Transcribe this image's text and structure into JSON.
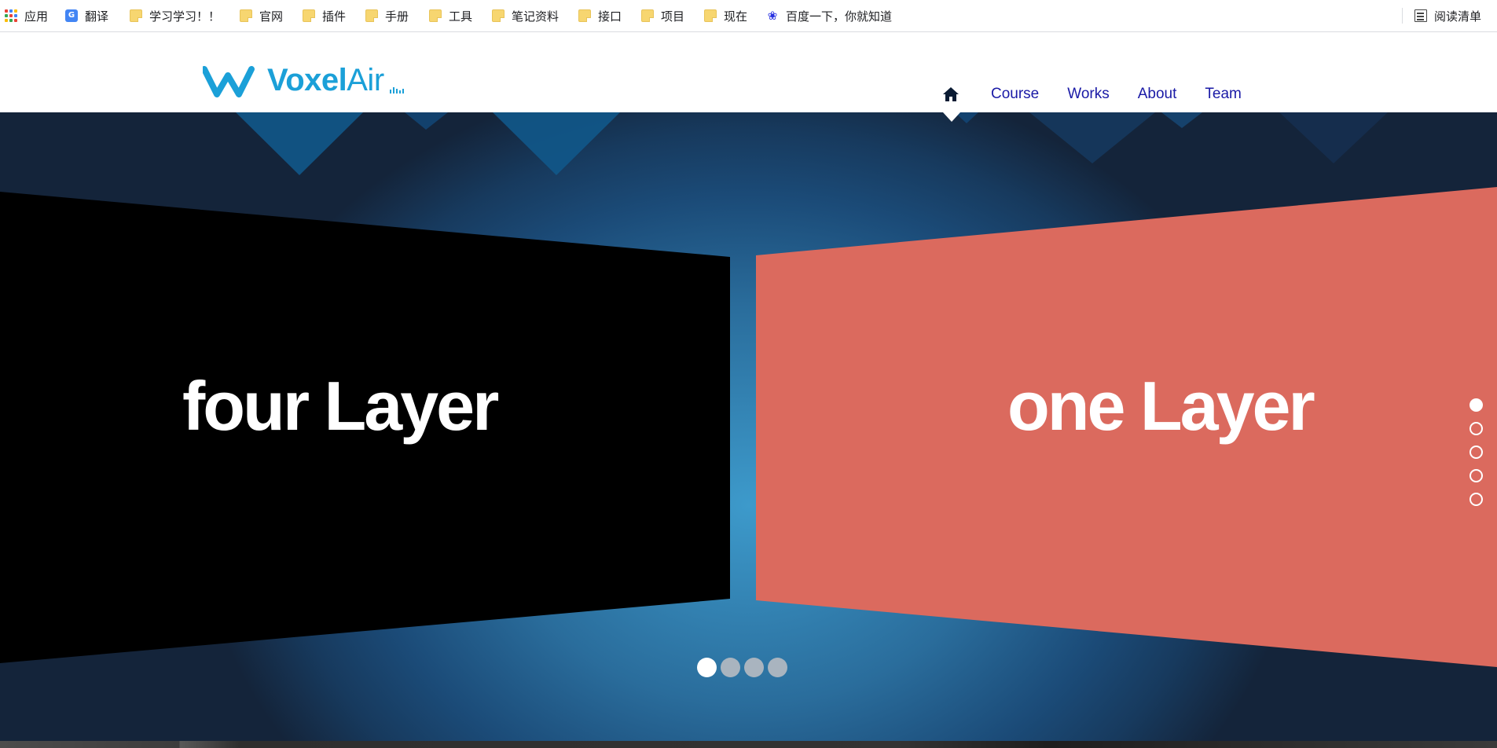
{
  "bookmarks": {
    "items": [
      {
        "label": "应用",
        "icon": "apps-icon"
      },
      {
        "label": "翻译",
        "icon": "translate-icon"
      },
      {
        "label": "学习学习！！",
        "icon": "folder-icon"
      },
      {
        "label": "官网",
        "icon": "folder-icon"
      },
      {
        "label": "插件",
        "icon": "folder-icon"
      },
      {
        "label": "手册",
        "icon": "folder-icon"
      },
      {
        "label": "工具",
        "icon": "folder-icon"
      },
      {
        "label": "笔记资料",
        "icon": "folder-icon"
      },
      {
        "label": "接口",
        "icon": "folder-icon"
      },
      {
        "label": "项目",
        "icon": "folder-icon"
      },
      {
        "label": "现在",
        "icon": "folder-icon"
      },
      {
        "label": "百度一下，你就知道",
        "icon": "baidu-icon"
      }
    ],
    "reading_list": {
      "label": "阅读清单",
      "icon": "reading-list-icon"
    }
  },
  "header": {
    "logo": {
      "part1": "Voxel",
      "part2": "Air"
    },
    "nav": {
      "home_icon": "home-icon",
      "items": [
        {
          "label": "Course"
        },
        {
          "label": "Works"
        },
        {
          "label": "About"
        },
        {
          "label": "Team"
        }
      ]
    }
  },
  "hero": {
    "slides": {
      "left": {
        "text": "four Layer",
        "color": "#000000"
      },
      "right": {
        "text": "one Layer",
        "color": "#db6a5e"
      }
    },
    "bottom_dots": {
      "count": 4,
      "active": 1
    },
    "side_dots": {
      "count": 5,
      "active": 1
    }
  },
  "colors": {
    "brand": "#1ba0d8",
    "nav_link": "#1a1aa6",
    "hero_center": "#3d9acb",
    "hero_edge": "#14243a"
  }
}
